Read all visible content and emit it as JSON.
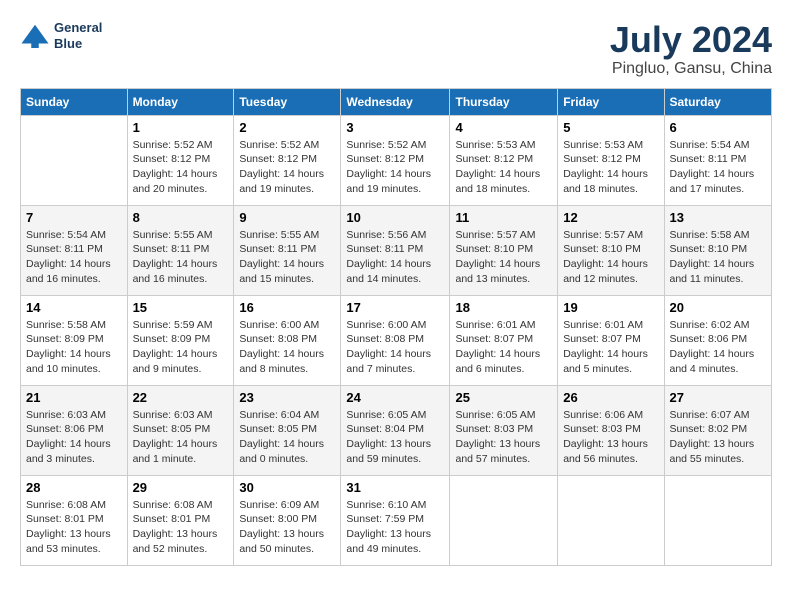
{
  "header": {
    "logo_line1": "General",
    "logo_line2": "Blue",
    "month_year": "July 2024",
    "location": "Pingluo, Gansu, China"
  },
  "weekdays": [
    "Sunday",
    "Monday",
    "Tuesday",
    "Wednesday",
    "Thursday",
    "Friday",
    "Saturday"
  ],
  "weeks": [
    [
      {
        "day": "",
        "info": ""
      },
      {
        "day": "1",
        "info": "Sunrise: 5:52 AM\nSunset: 8:12 PM\nDaylight: 14 hours\nand 20 minutes."
      },
      {
        "day": "2",
        "info": "Sunrise: 5:52 AM\nSunset: 8:12 PM\nDaylight: 14 hours\nand 19 minutes."
      },
      {
        "day": "3",
        "info": "Sunrise: 5:52 AM\nSunset: 8:12 PM\nDaylight: 14 hours\nand 19 minutes."
      },
      {
        "day": "4",
        "info": "Sunrise: 5:53 AM\nSunset: 8:12 PM\nDaylight: 14 hours\nand 18 minutes."
      },
      {
        "day": "5",
        "info": "Sunrise: 5:53 AM\nSunset: 8:12 PM\nDaylight: 14 hours\nand 18 minutes."
      },
      {
        "day": "6",
        "info": "Sunrise: 5:54 AM\nSunset: 8:11 PM\nDaylight: 14 hours\nand 17 minutes."
      }
    ],
    [
      {
        "day": "7",
        "info": "Sunrise: 5:54 AM\nSunset: 8:11 PM\nDaylight: 14 hours\nand 16 minutes."
      },
      {
        "day": "8",
        "info": "Sunrise: 5:55 AM\nSunset: 8:11 PM\nDaylight: 14 hours\nand 16 minutes."
      },
      {
        "day": "9",
        "info": "Sunrise: 5:55 AM\nSunset: 8:11 PM\nDaylight: 14 hours\nand 15 minutes."
      },
      {
        "day": "10",
        "info": "Sunrise: 5:56 AM\nSunset: 8:11 PM\nDaylight: 14 hours\nand 14 minutes."
      },
      {
        "day": "11",
        "info": "Sunrise: 5:57 AM\nSunset: 8:10 PM\nDaylight: 14 hours\nand 13 minutes."
      },
      {
        "day": "12",
        "info": "Sunrise: 5:57 AM\nSunset: 8:10 PM\nDaylight: 14 hours\nand 12 minutes."
      },
      {
        "day": "13",
        "info": "Sunrise: 5:58 AM\nSunset: 8:10 PM\nDaylight: 14 hours\nand 11 minutes."
      }
    ],
    [
      {
        "day": "14",
        "info": "Sunrise: 5:58 AM\nSunset: 8:09 PM\nDaylight: 14 hours\nand 10 minutes."
      },
      {
        "day": "15",
        "info": "Sunrise: 5:59 AM\nSunset: 8:09 PM\nDaylight: 14 hours\nand 9 minutes."
      },
      {
        "day": "16",
        "info": "Sunrise: 6:00 AM\nSunset: 8:08 PM\nDaylight: 14 hours\nand 8 minutes."
      },
      {
        "day": "17",
        "info": "Sunrise: 6:00 AM\nSunset: 8:08 PM\nDaylight: 14 hours\nand 7 minutes."
      },
      {
        "day": "18",
        "info": "Sunrise: 6:01 AM\nSunset: 8:07 PM\nDaylight: 14 hours\nand 6 minutes."
      },
      {
        "day": "19",
        "info": "Sunrise: 6:01 AM\nSunset: 8:07 PM\nDaylight: 14 hours\nand 5 minutes."
      },
      {
        "day": "20",
        "info": "Sunrise: 6:02 AM\nSunset: 8:06 PM\nDaylight: 14 hours\nand 4 minutes."
      }
    ],
    [
      {
        "day": "21",
        "info": "Sunrise: 6:03 AM\nSunset: 8:06 PM\nDaylight: 14 hours\nand 3 minutes."
      },
      {
        "day": "22",
        "info": "Sunrise: 6:03 AM\nSunset: 8:05 PM\nDaylight: 14 hours\nand 1 minute."
      },
      {
        "day": "23",
        "info": "Sunrise: 6:04 AM\nSunset: 8:05 PM\nDaylight: 14 hours\nand 0 minutes."
      },
      {
        "day": "24",
        "info": "Sunrise: 6:05 AM\nSunset: 8:04 PM\nDaylight: 13 hours\nand 59 minutes."
      },
      {
        "day": "25",
        "info": "Sunrise: 6:05 AM\nSunset: 8:03 PM\nDaylight: 13 hours\nand 57 minutes."
      },
      {
        "day": "26",
        "info": "Sunrise: 6:06 AM\nSunset: 8:03 PM\nDaylight: 13 hours\nand 56 minutes."
      },
      {
        "day": "27",
        "info": "Sunrise: 6:07 AM\nSunset: 8:02 PM\nDaylight: 13 hours\nand 55 minutes."
      }
    ],
    [
      {
        "day": "28",
        "info": "Sunrise: 6:08 AM\nSunset: 8:01 PM\nDaylight: 13 hours\nand 53 minutes."
      },
      {
        "day": "29",
        "info": "Sunrise: 6:08 AM\nSunset: 8:01 PM\nDaylight: 13 hours\nand 52 minutes."
      },
      {
        "day": "30",
        "info": "Sunrise: 6:09 AM\nSunset: 8:00 PM\nDaylight: 13 hours\nand 50 minutes."
      },
      {
        "day": "31",
        "info": "Sunrise: 6:10 AM\nSunset: 7:59 PM\nDaylight: 13 hours\nand 49 minutes."
      },
      {
        "day": "",
        "info": ""
      },
      {
        "day": "",
        "info": ""
      },
      {
        "day": "",
        "info": ""
      }
    ]
  ]
}
